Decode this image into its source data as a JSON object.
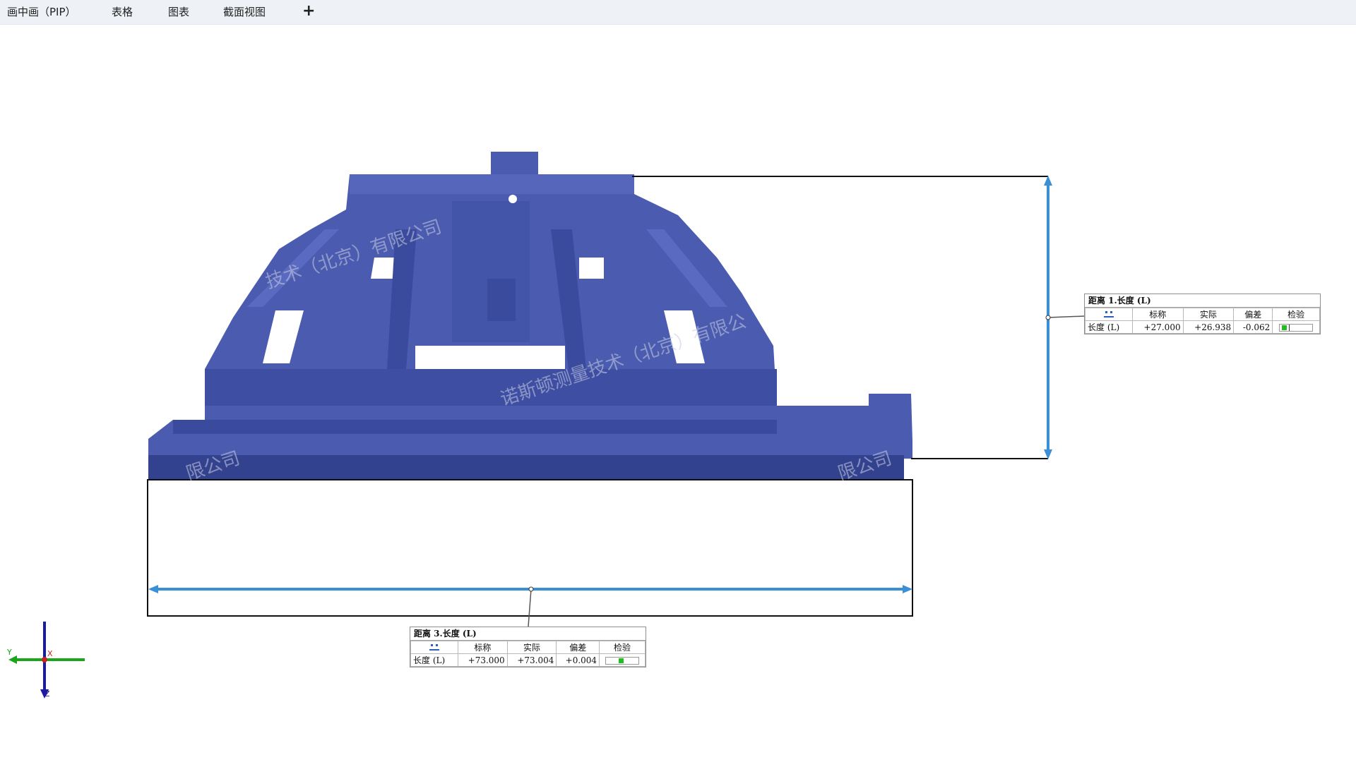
{
  "tabs": [
    {
      "label": "画中画（PIP）"
    },
    {
      "label": "表格"
    },
    {
      "label": "图表"
    },
    {
      "label": "截面视图"
    }
  ],
  "add_tab_label": "+",
  "watermark": {
    "text1": "技术（北京）有限公司",
    "text2": "诺斯顿测量技术（北京）有限公",
    "text3": "限公司",
    "text4": "限公司"
  },
  "dimension_1": {
    "title": "距离 1.长度 (L)",
    "headers": [
      "标称",
      "实际",
      "偏差",
      "检验"
    ],
    "row_label": "长度 (L)",
    "nominal": "+27.000",
    "actual": "+26.938",
    "deviation": "-0.062",
    "status": "pass"
  },
  "dimension_3": {
    "title": "距离 3.长度 (L)",
    "headers": [
      "标称",
      "实际",
      "偏差",
      "检验"
    ],
    "row_label": "长度 (L)",
    "nominal": "+73.000",
    "actual": "+73.004",
    "deviation": "+0.004",
    "status": "pass"
  },
  "axis_triad": {
    "labels": [
      "Z",
      "Y",
      "X"
    ],
    "colors": {
      "z": "#1a1aa6",
      "y": "#1aa61a",
      "x": "#cc2222"
    }
  },
  "colors": {
    "part": "#4a5bb0",
    "part_dark": "#34428f",
    "dimension_line": "#3a8fd6",
    "pass": "#1fbf1f"
  }
}
